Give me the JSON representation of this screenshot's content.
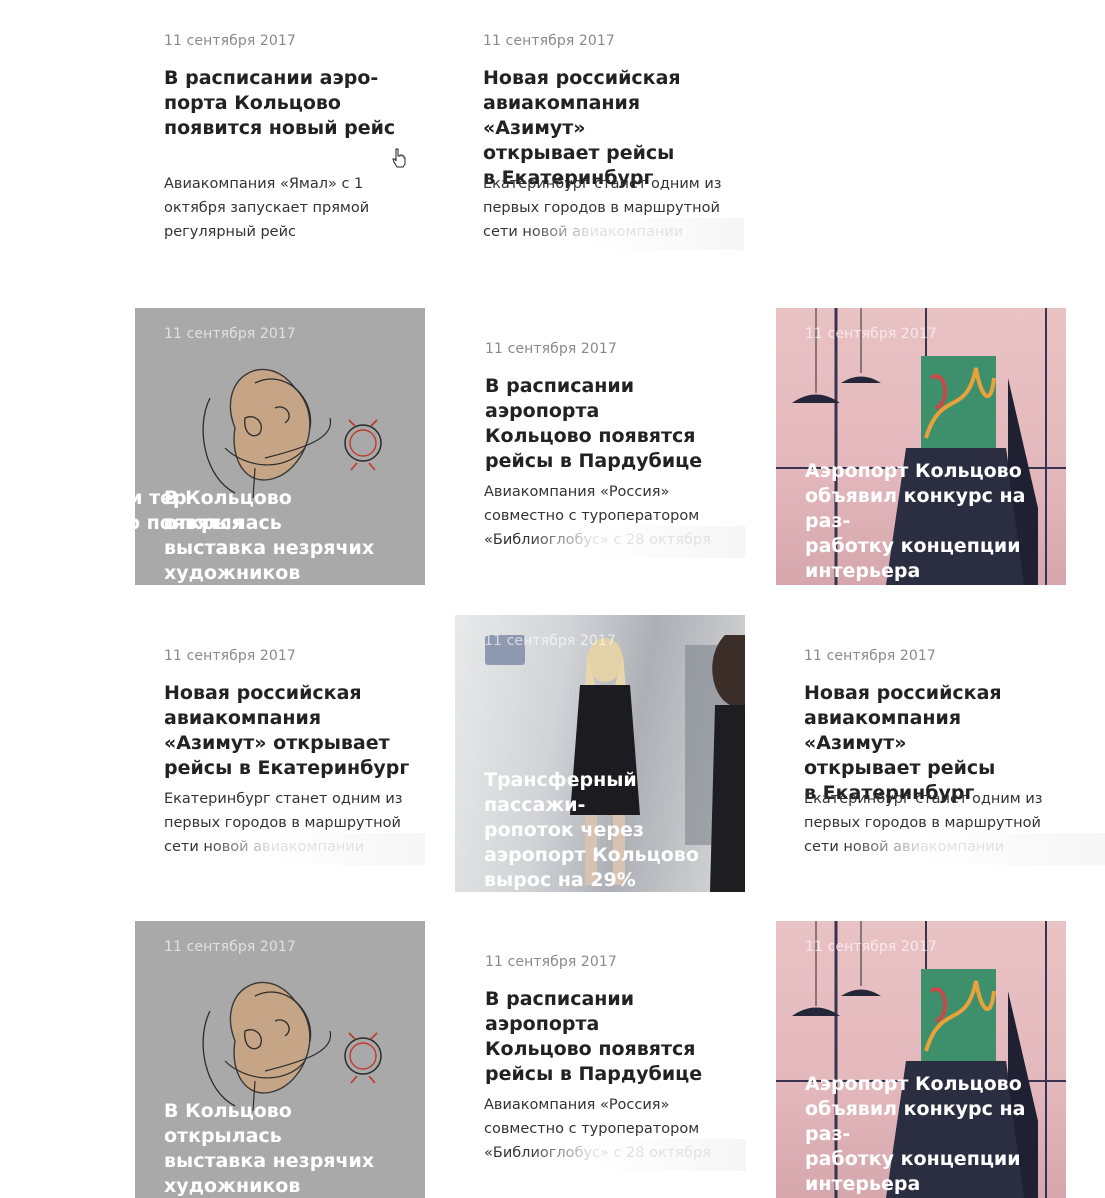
{
  "cards": [
    {
      "date": "11 сентября 2017",
      "title": "В расписании аэро-\nпорта Кольцово\nпоявится новый рейс",
      "excerpt": "Авиакомпания «Ямал» с 1 октября запускает прямой регулярный рейс"
    },
    {
      "date": "11 сентября 2017",
      "title": "Новая российская\nавиакомпания «Азимут»\nоткрывает рейсы\nв Екатеринбург",
      "excerpt": "Екатеринбург станет одним из первых городов в маршрутной сети новой авиакомпании"
    },
    {
      "date": "11 сентября 2017",
      "title": "В Кольцово открылась\nвыставка незрячих\nхудожников",
      "ghost": "м тер\nо появятся"
    },
    {
      "date": "11 сентября 2017",
      "title": "В расписании аэропорта\nКольцово появятся\nрейсы в Пардубице",
      "excerpt": "Авиакомпания «Россия» совместно с туроператором «Библиоглобус» с 28 октября"
    },
    {
      "date": "11 сентября 2017",
      "title": "Аэропорт Кольцово\nобъявил конкурс на раз-\nработку концепции\nинтерьера"
    },
    {
      "date": "11 сентября 2017",
      "title": "Новая российская\nавиакомпания\n«Азимут» открывает\nрейсы в Екатеринбург",
      "excerpt": "Екатеринбург станет одним из первых городов в маршрутной сети новой авиакомпании"
    },
    {
      "date": "11 сентября 2017",
      "title": "Трансферный пассажи-\nропоток через\nаэропорт Кольцово\nвырос на 29%"
    },
    {
      "date": "11 сентября 2017",
      "title": "Новая российская\nавиакомпания «Азимут»\nоткрывает рейсы\nв Екатеринбург",
      "excerpt": "Екатеринбург станет одним из первых городов в маршрутной сети новой авиакомпании"
    },
    {
      "date": "11 сентября 2017",
      "title": "В Кольцово открылась\nвыставка незрячих\nхудожников"
    },
    {
      "date": "11 сентября 2017",
      "title": "В расписании аэропорта\nКольцово появятся\nрейсы в Пардубице",
      "excerpt": "Авиакомпания «Россия» совместно с туроператором «Библиоглобус» с 28 октября"
    },
    {
      "date": "11 сентября 2017",
      "title": "Аэропорт Кольцово\nобъявил конкурс на раз-\nработку концепции\nинтерьера"
    }
  ],
  "colors": {
    "text": "#222222",
    "date": "#8a8a8a",
    "gray_card": "#a9a9a9",
    "pink_card": "#e4b9bd"
  },
  "icons": [
    "pointer-cursor-icon"
  ]
}
